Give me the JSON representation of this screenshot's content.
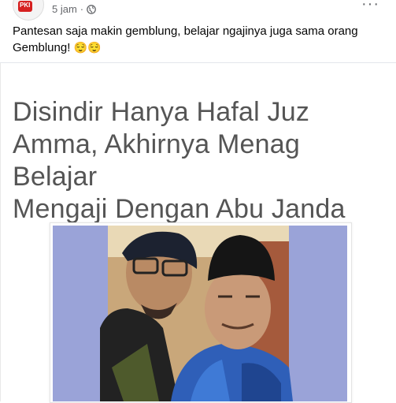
{
  "post": {
    "time": "5 jam",
    "separator": "·",
    "text_line1": "Pantesan saja makin gemblung, belajar ngajinya juga sama orang",
    "text_line2": "Gemblung!",
    "emojis": "😌😌",
    "avatar_badge": "PKI"
  },
  "shared": {
    "headline_line1": "Disindir Hanya Hafal Juz",
    "headline_line2": "Amma, Akhirnya Menag Belajar",
    "headline_line3": "Mengaji Dengan Abu Janda"
  },
  "icons": {
    "globe": "globe-icon",
    "more": "more-options-icon"
  },
  "colors": {
    "photo_background": "#9aa3d8",
    "text_secondary": "#65676b",
    "headline": "#555555"
  }
}
